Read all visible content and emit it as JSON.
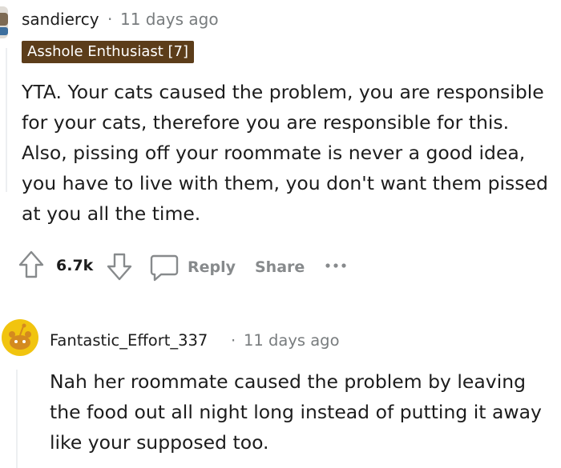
{
  "comment": {
    "username": "sandiercy",
    "separator": "·",
    "timestamp": "11 days ago",
    "flair": "Asshole Enthusiast [7]",
    "body": "YTA. Your cats caused the problem, you are responsible for your cats, therefore you are responsible for this. Also, pissing off your roommate is never a good idea, you have to live with them, you don't want them pissed at you all the time.",
    "votes": "6.7k",
    "actions": {
      "reply": "Reply",
      "share": "Share",
      "more": "···"
    }
  },
  "reply": {
    "username": "Fantastic_Effort_337",
    "separator": "·",
    "timestamp": "11 days ago",
    "body": "Nah her roommate caused the problem by leaving the food out all night long instead of putting it away like your supposed too."
  },
  "colors": {
    "flair_bg": "#5c3d1a",
    "meta_text": "#787c7e",
    "action_text": "#878a8c",
    "avatar_yellow": "#f1c40f"
  },
  "icons": {
    "upvote": "upvote-arrow-icon",
    "downvote": "downvote-arrow-icon",
    "reply": "speech-bubble-icon",
    "more": "more-options-icon",
    "avatar": "snoo-avatar-icon"
  }
}
